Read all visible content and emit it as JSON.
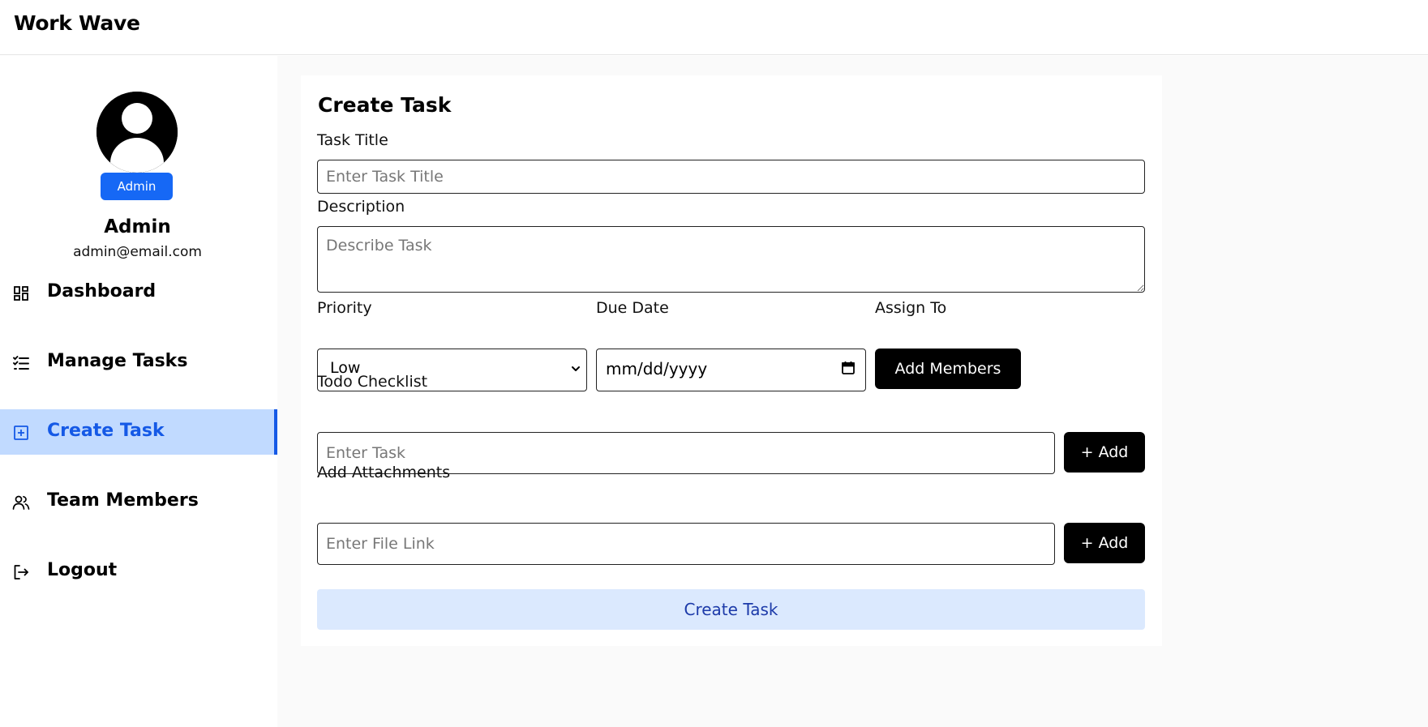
{
  "app": {
    "brand": "Work Wave"
  },
  "user": {
    "role_badge": "Admin",
    "name": "Admin",
    "email": "admin@email.com"
  },
  "sidebar": {
    "items": [
      {
        "label": "Dashboard",
        "icon": "dashboard-icon",
        "active": false
      },
      {
        "label": "Manage Tasks",
        "icon": "list-check-icon",
        "active": false
      },
      {
        "label": "Create Task",
        "icon": "square-plus-icon",
        "active": true
      },
      {
        "label": "Team Members",
        "icon": "users-icon",
        "active": false
      },
      {
        "label": "Logout",
        "icon": "logout-icon",
        "active": false
      }
    ]
  },
  "form": {
    "title": "Create Task",
    "task_title": {
      "label": "Task Title",
      "placeholder": "Enter Task Title",
      "value": ""
    },
    "description": {
      "label": "Description",
      "placeholder": "Describe Task",
      "value": ""
    },
    "priority": {
      "label": "Priority",
      "value": "Low"
    },
    "due_date": {
      "label": "Due Date",
      "value": "mm/dd/yyyy"
    },
    "assign": {
      "label": "Assign To",
      "button": "Add Members"
    },
    "todo": {
      "label": "Todo Checklist",
      "placeholder": "Enter Task",
      "button": "+ Add"
    },
    "attachments": {
      "label": "Add Attachments",
      "placeholder": "Enter File Link",
      "button": "+ Add"
    },
    "submit": "Create Task"
  },
  "colors": {
    "accent": "#1559e6",
    "active_bg": "#c1daff",
    "badge": "#1668f5",
    "submit_bg": "#dbe9fe",
    "submit_text": "#1c3aa9"
  }
}
